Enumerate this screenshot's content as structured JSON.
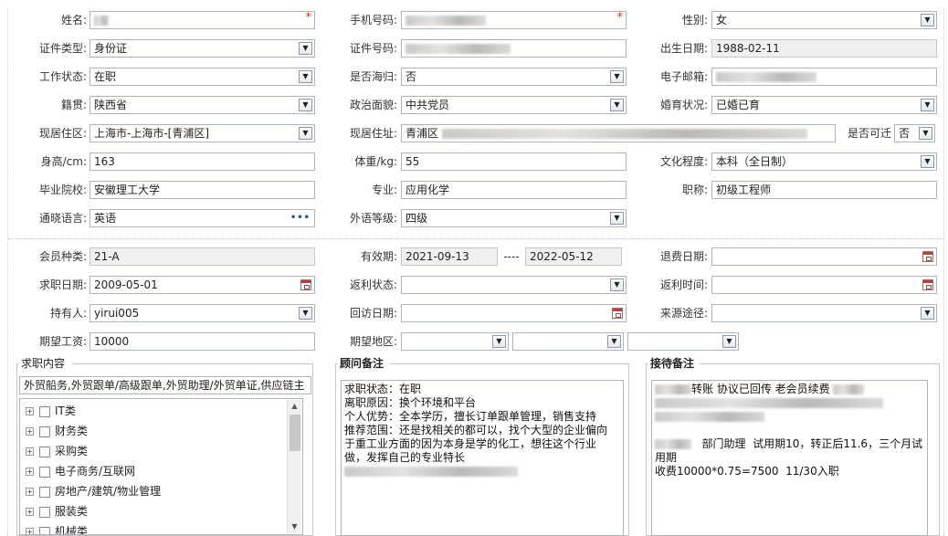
{
  "labels": {
    "name": "姓名:",
    "mobile": "手机号码:",
    "gender": "性别:",
    "id_type": "证件类型:",
    "id_no": "证件号码:",
    "birth": "出生日期:",
    "work_status": "工作状态:",
    "overseas": "是否海归:",
    "email": "电子邮箱:",
    "native": "籍贯:",
    "political": "政治面貌:",
    "marital": "婚育状况:",
    "res_area": "现居住区:",
    "res_addr": "现居住址:",
    "relocate": "是否可迁",
    "height": "身高/cm:",
    "weight": "体重/kg:",
    "education": "文化程度:",
    "school": "毕业院校:",
    "major": "专业:",
    "title": "职称:",
    "language": "通晓语言:",
    "lang_level": "外语等级:",
    "member_type": "会员种类:",
    "valid": "有效期:",
    "valid_sep": "----",
    "refund_date": "退费日期:",
    "job_date": "求职日期:",
    "rebate_status": "返利状态:",
    "rebate_time": "返利时间:",
    "holder": "持有人:",
    "visit_date": "回访日期:",
    "source": "来源途径:",
    "salary": "期望工资:",
    "region": "期望地区:"
  },
  "values": {
    "gender": "女",
    "id_type": "身份证",
    "birth": "1988-02-11",
    "work_status": "在职",
    "overseas": "否",
    "native": "陕西省",
    "political": "中共党员",
    "marital": "已婚已育",
    "res_area": "上海市-上海市-[青浦区]",
    "res_addr_prefix": "青浦区",
    "relocate": "否",
    "height": "163",
    "weight": "55",
    "education": "本科（全日制）",
    "school": "安徽理工大学",
    "major": "应用化学",
    "title": "初级工程师",
    "language": "英语",
    "lang_level": "四级",
    "member_type": "21-A",
    "valid_from": "2021-09-13",
    "valid_to": "2022-05-12",
    "job_date": "2009-05-01",
    "holder": "yirui005",
    "salary": "10000"
  },
  "required_mark": "*",
  "job_content": {
    "title": "求职内容",
    "summary": "外贸船务,外贸跟单/高级跟单,外贸助理/外贸单证,供应链主",
    "tree": [
      "IT类",
      "财务类",
      "采购类",
      "电子商务/互联网",
      "房地产/建筑/物业管理",
      "服装类",
      "机械类"
    ]
  },
  "advisor_notes": {
    "title": "顾问备注",
    "lines": [
      "求职状态：在职",
      "离职原因：换个环境和平台",
      "个人优势：全本学历，擅长订单跟单管理，销售支持",
      "推荐范围：还是找相关的都可以，找个大型的企业偏向",
      "于重工业方面的因为本身是学的化工，想往这个行业",
      "做，发挥自己的专业特长"
    ]
  },
  "reception_notes": {
    "title": "接待备注",
    "line1_suffix": "转账 协议已回传 老会员续费",
    "line4_suffix": "部门助理  试用期10，转正后11.6，三个月试",
    "line5": "用期",
    "line6": "收费10000*0.75=7500  11/30入职"
  },
  "icons": {
    "dropdown": "chevron-down-icon",
    "calendar": "calendar-icon",
    "more": "ellipsis-icon",
    "expand": "plus-box-icon",
    "checkbox": "checkbox-icon"
  },
  "colors": {
    "required": "#e0281c",
    "border": "#a9b4c1",
    "readonly_bg": "#f0f0f0"
  }
}
